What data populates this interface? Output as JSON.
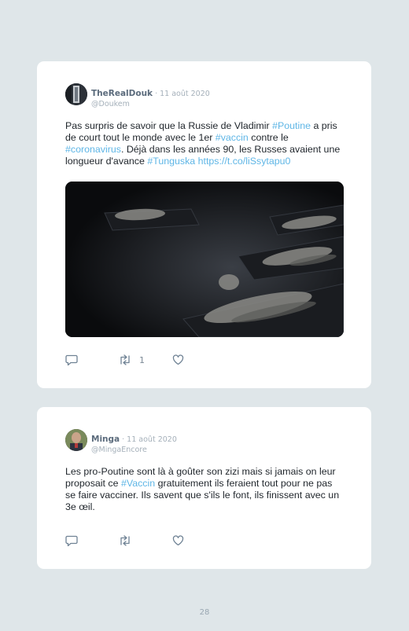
{
  "tweets": [
    {
      "display_name": "TheRealDouk",
      "date": " · 11 août 2020",
      "handle": "@Doukem",
      "text_parts": [
        {
          "t": "Pas surpris de savoir que la Russie de Vladimir ",
          "hl": false
        },
        {
          "t": "#Poutine",
          "hl": true
        },
        {
          "t": " a pris de court tout le monde avec le 1er ",
          "hl": false
        },
        {
          "t": "#vaccin",
          "hl": true
        },
        {
          "t": " contre le ",
          "hl": false
        },
        {
          "t": "#coronavirus",
          "hl": true
        },
        {
          "t": ". Déjà dans les années 90, les Russes avaient une longueur d'avance ",
          "hl": false
        },
        {
          "t": "#Tunguska",
          "hl": true
        },
        {
          "t": " ",
          "hl": false
        },
        {
          "t": "https://t.co/liSsytapu0",
          "hl": true
        }
      ],
      "retweet_count": "1"
    },
    {
      "display_name": "Minga",
      "date": " · 11 août 2020",
      "handle": "@MingaEncore",
      "text_parts": [
        {
          "t": "Les pro-Poutine sont là à goûter son zizi mais si jamais on leur proposait ce ",
          "hl": false
        },
        {
          "t": "#Vaccin",
          "hl": true
        },
        {
          "t": " gratuitement ils feraient tout pour ne pas se faire vacciner. Ils savent que s'ils le font, ils finissent avec un 3e œil.",
          "hl": false
        }
      ],
      "retweet_count": ""
    }
  ],
  "page_number": "28",
  "colors": {
    "background": "#dfe6e9",
    "card": "#ffffff",
    "hashtag": "#5fb6e6",
    "name": "#5b6b7c",
    "muted": "#a5b0ba",
    "icon": "#6f8294"
  },
  "icons": {
    "reply": "speech-bubble-icon",
    "retweet": "retweet-arrows-icon",
    "like": "heart-icon"
  }
}
